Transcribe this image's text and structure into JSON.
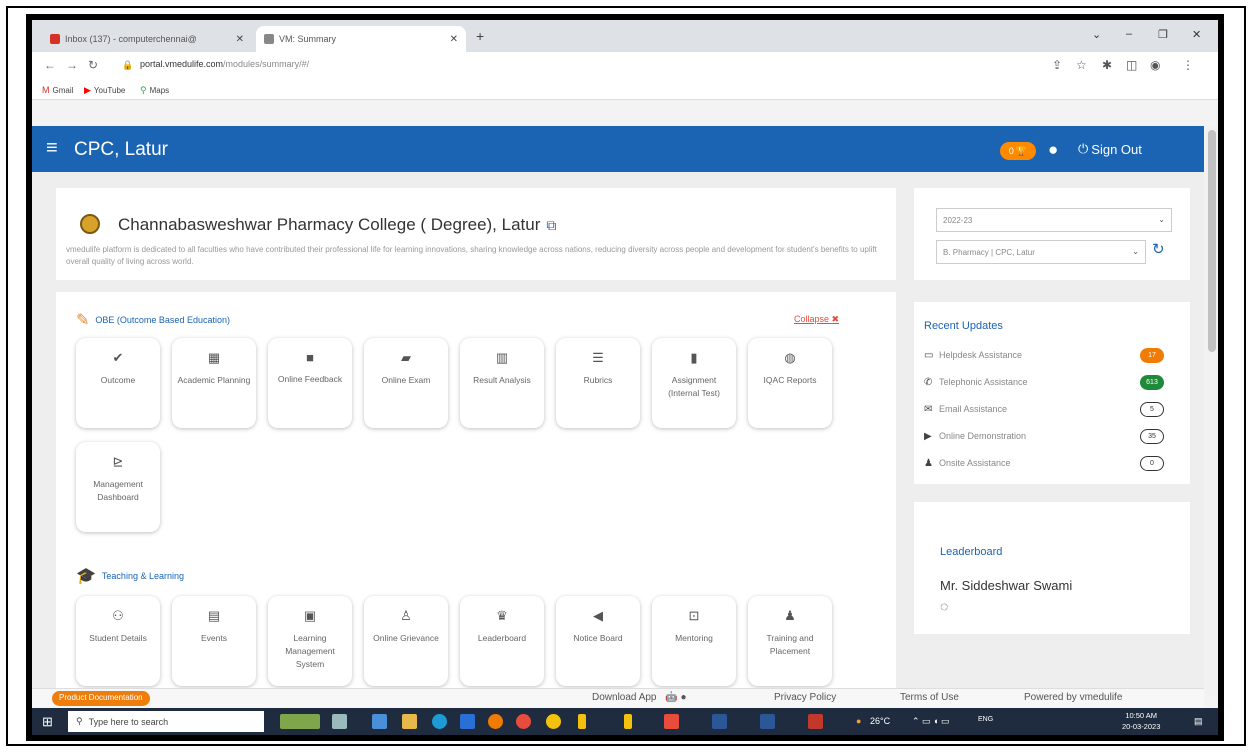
{
  "browser": {
    "tabs": [
      {
        "title": "Inbox (137) - computerchennai@",
        "state": "inactive",
        "favicon_color": "#d93025"
      },
      {
        "title": "VM: Summary",
        "state": "active",
        "favicon_color": "#888888"
      }
    ],
    "new_tab_glyph": "+",
    "url_host": "portal.vmedulife.com",
    "url_path": "/modules/summary/#/",
    "bookmarks": [
      {
        "label": "Gmail",
        "icon": "gmail-icon",
        "glyph": "M",
        "color": "#d93025"
      },
      {
        "label": "YouTube",
        "icon": "youtube-icon",
        "glyph": "▶",
        "color": "#ff0000"
      },
      {
        "label": "Maps",
        "icon": "maps-icon",
        "glyph": "⚲",
        "color": "#34a853"
      }
    ]
  },
  "app": {
    "title": "CPC, Latur",
    "trophy_count": "0",
    "sign_out_label": "Sign Out",
    "accent": "#1b63b3"
  },
  "college": {
    "name": "Channabasweshwar Pharmacy College ( Degree), Latur",
    "description": "vmedulife platform is dedicated to all faculties who have contributed their professional life for learning innovations, sharing knowledge across nations, reducing diversity across people and development for student's benefits to uplift overall quality of living across world."
  },
  "obe": {
    "title": "OBE (Outcome Based Education)",
    "collapse_label": "Collapse",
    "tiles": [
      {
        "label": "Outcome",
        "icon": "check-icon",
        "glyph": "✔"
      },
      {
        "label": "Academic Planning",
        "icon": "calendar-icon",
        "glyph": "▦"
      },
      {
        "label": "Online Feedback",
        "icon": "comment-icon",
        "glyph": "■"
      },
      {
        "label": "Online Exam",
        "icon": "folder-icon",
        "glyph": "▰"
      },
      {
        "label": "Result Analysis",
        "icon": "bar-chart-icon",
        "glyph": "▥"
      },
      {
        "label": "Rubrics",
        "icon": "list-icon",
        "glyph": "☰"
      },
      {
        "label": "Assignment (Internal Test)",
        "icon": "file-icon",
        "glyph": "▮"
      },
      {
        "label": "IQAC Reports",
        "icon": "globe-icon",
        "glyph": "◍"
      },
      {
        "label": "Management Dashboard",
        "icon": "line-chart-icon",
        "glyph": "⊵"
      }
    ]
  },
  "teaching": {
    "title": "Teaching & Learning",
    "tiles": [
      {
        "label": "Student Details",
        "icon": "users-icon",
        "glyph": "⚇"
      },
      {
        "label": "Events",
        "icon": "calendar-check-icon",
        "glyph": "▤"
      },
      {
        "label": "Learning Management System",
        "icon": "book-icon",
        "glyph": "▣"
      },
      {
        "label": "Online Grievance",
        "icon": "person-icon",
        "glyph": "♙"
      },
      {
        "label": "Leaderboard",
        "icon": "trophy-icon",
        "glyph": "♛"
      },
      {
        "label": "Notice Board",
        "icon": "bullhorn-icon",
        "glyph": "◀"
      },
      {
        "label": "Mentoring",
        "icon": "chalkboard-icon",
        "glyph": "⊡"
      },
      {
        "label": "Training and Placement",
        "icon": "user-tie-icon",
        "glyph": "♟"
      }
    ]
  },
  "filters": {
    "year": "2022-23",
    "program": "B. Pharmacy | CPC, Latur"
  },
  "updates": {
    "title": "Recent Updates",
    "items": [
      {
        "label": "Helpdesk Assistance",
        "icon": "desktop-icon",
        "glyph": "▭",
        "count": "17",
        "style": "b-orange"
      },
      {
        "label": "Telephonic Assistance",
        "icon": "phone-icon",
        "glyph": "✆",
        "count": "613",
        "style": "b-green"
      },
      {
        "label": "Email Assistance",
        "icon": "envelope-icon",
        "glyph": "✉",
        "count": "5",
        "style": "b-outline"
      },
      {
        "label": "Online Demonstration",
        "icon": "video-icon",
        "glyph": "▶",
        "count": "35",
        "style": "b-outline"
      },
      {
        "label": "Onsite Assistance",
        "icon": "user-cog-icon",
        "glyph": "♟",
        "count": "0",
        "style": "b-outline"
      }
    ]
  },
  "leaderboard": {
    "title": "Leaderboard",
    "name": "Mr. Siddeshwar Swami"
  },
  "footer": {
    "product_doc": "Product Documentation",
    "download_app": "Download App",
    "privacy": "Privacy Policy",
    "terms": "Terms of Use",
    "powered": "Powered by vmedulife"
  },
  "taskbar": {
    "search_placeholder": "Type here to search",
    "temperature": "26°C",
    "language": "ENG",
    "time": "10:50 AM",
    "date": "20-03-2023"
  }
}
